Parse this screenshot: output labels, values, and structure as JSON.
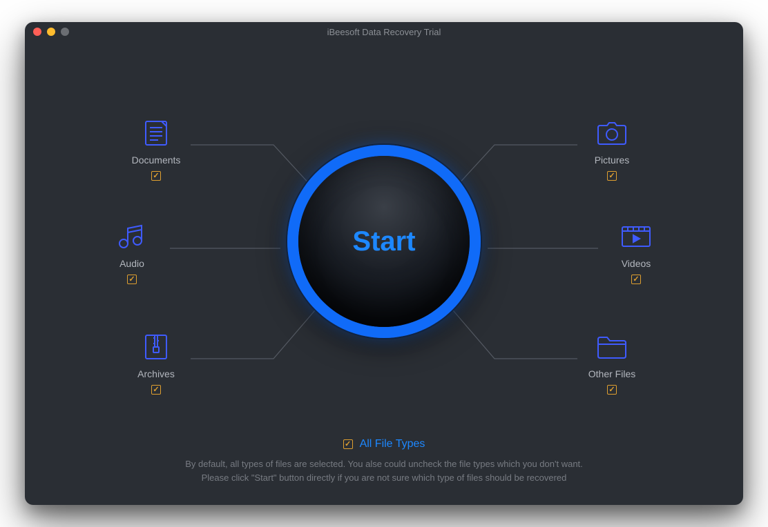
{
  "window": {
    "title": "iBeesoft Data Recovery Trial"
  },
  "start": {
    "label": "Start"
  },
  "categories": {
    "documents": {
      "label": "Documents",
      "checked": true
    },
    "audio": {
      "label": "Audio",
      "checked": true
    },
    "archives": {
      "label": "Archives",
      "checked": true
    },
    "pictures": {
      "label": "Pictures",
      "checked": true
    },
    "videos": {
      "label": "Videos",
      "checked": true
    },
    "other": {
      "label": "Other Files",
      "checked": true
    }
  },
  "all_types": {
    "label": "All File Types",
    "checked": true
  },
  "help": {
    "line1": "By default, all types of files are selected. You alse could uncheck the file types which you don't want.",
    "line2": "Please click \"Start\" button directly if you are not sure which type of files should be recovered"
  }
}
